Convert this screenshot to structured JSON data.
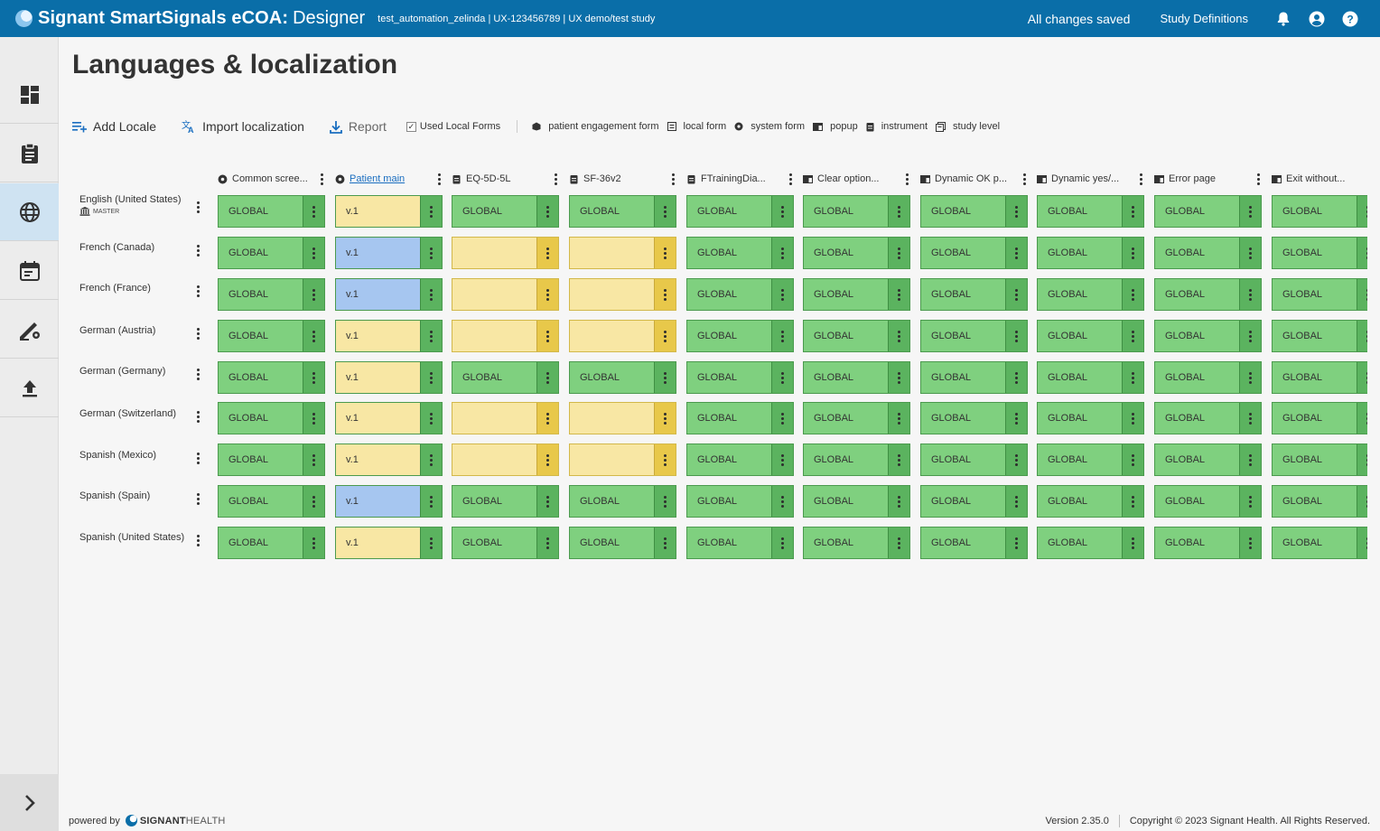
{
  "header": {
    "brand_title": "Signant SmartSignals eCOA:",
    "brand_sub": "Designer",
    "study_info": "test_automation_zelinda | UX-123456789 | UX demo/test study",
    "save_status": "All changes saved",
    "study_definitions": "Study Definitions",
    "icons": [
      "bell-icon",
      "account-icon",
      "help-icon"
    ]
  },
  "sidebar": {
    "items": [
      "dashboard-icon",
      "forms-icon",
      "globe-icon",
      "calendar-icon",
      "design-settings-icon",
      "upload-icon"
    ],
    "active": "globe-icon",
    "expand": "chevron-right-icon"
  },
  "page": {
    "title": "Languages & localization"
  },
  "toolbar": {
    "add_locale": "Add Locale",
    "import_localization": "Import localization",
    "report": "Report",
    "used_local_forms": "Used Local Forms",
    "used_local_forms_checked": true
  },
  "legend": {
    "patient_engagement_form": "patient engagement form",
    "local_form": "local form",
    "system_form": "system form",
    "popup": "popup",
    "instrument": "instrument",
    "study_level": "study level"
  },
  "columns": [
    {
      "label": "Common scree...",
      "icon": "system-form-icon"
    },
    {
      "label": "Patient main",
      "icon": "system-form-icon",
      "link": true
    },
    {
      "label": "EQ-5D-5L",
      "icon": "instrument-icon"
    },
    {
      "label": "SF-36v2",
      "icon": "instrument-icon"
    },
    {
      "label": "FTrainingDia...",
      "icon": "instrument-icon"
    },
    {
      "label": "Clear option...",
      "icon": "popup-icon"
    },
    {
      "label": "Dynamic OK p...",
      "icon": "popup-icon"
    },
    {
      "label": "Dynamic yes/...",
      "icon": "popup-icon"
    },
    {
      "label": "Error page",
      "icon": "popup-icon"
    },
    {
      "label": "Exit without...",
      "icon": "popup-icon"
    }
  ],
  "rows": [
    {
      "locale": "English (United States)",
      "badge": "MASTER",
      "cells": [
        [
          "GLOBAL",
          "green"
        ],
        [
          "v.1",
          "yellowg"
        ],
        [
          "GLOBAL",
          "green"
        ],
        [
          "GLOBAL",
          "green"
        ],
        [
          "GLOBAL",
          "green"
        ],
        [
          "GLOBAL",
          "green"
        ],
        [
          "GLOBAL",
          "green"
        ],
        [
          "GLOBAL",
          "green"
        ],
        [
          "GLOBAL",
          "green"
        ],
        [
          "GLOBAL",
          "green"
        ]
      ]
    },
    {
      "locale": "French (Canada)",
      "cells": [
        [
          "GLOBAL",
          "green"
        ],
        [
          "v.1",
          "blue"
        ],
        [
          "",
          "yellow"
        ],
        [
          "",
          "yellow"
        ],
        [
          "GLOBAL",
          "green"
        ],
        [
          "GLOBAL",
          "green"
        ],
        [
          "GLOBAL",
          "green"
        ],
        [
          "GLOBAL",
          "green"
        ],
        [
          "GLOBAL",
          "green"
        ],
        [
          "GLOBAL",
          "green"
        ]
      ]
    },
    {
      "locale": "French (France)",
      "cells": [
        [
          "GLOBAL",
          "green"
        ],
        [
          "v.1",
          "blue"
        ],
        [
          "",
          "yellow"
        ],
        [
          "",
          "yellow"
        ],
        [
          "GLOBAL",
          "green"
        ],
        [
          "GLOBAL",
          "green"
        ],
        [
          "GLOBAL",
          "green"
        ],
        [
          "GLOBAL",
          "green"
        ],
        [
          "GLOBAL",
          "green"
        ],
        [
          "GLOBAL",
          "green"
        ]
      ]
    },
    {
      "locale": "German (Austria)",
      "cells": [
        [
          "GLOBAL",
          "green"
        ],
        [
          "v.1",
          "yellowg"
        ],
        [
          "",
          "yellow"
        ],
        [
          "",
          "yellow"
        ],
        [
          "GLOBAL",
          "green"
        ],
        [
          "GLOBAL",
          "green"
        ],
        [
          "GLOBAL",
          "green"
        ],
        [
          "GLOBAL",
          "green"
        ],
        [
          "GLOBAL",
          "green"
        ],
        [
          "GLOBAL",
          "green"
        ]
      ]
    },
    {
      "locale": "German (Germany)",
      "cells": [
        [
          "GLOBAL",
          "green"
        ],
        [
          "v.1",
          "yellowg"
        ],
        [
          "GLOBAL",
          "green"
        ],
        [
          "GLOBAL",
          "green"
        ],
        [
          "GLOBAL",
          "green"
        ],
        [
          "GLOBAL",
          "green"
        ],
        [
          "GLOBAL",
          "green"
        ],
        [
          "GLOBAL",
          "green"
        ],
        [
          "GLOBAL",
          "green"
        ],
        [
          "GLOBAL",
          "green"
        ]
      ]
    },
    {
      "locale": "German (Switzerland)",
      "cells": [
        [
          "GLOBAL",
          "green"
        ],
        [
          "v.1",
          "yellowg"
        ],
        [
          "",
          "yellow"
        ],
        [
          "",
          "yellow"
        ],
        [
          "GLOBAL",
          "green"
        ],
        [
          "GLOBAL",
          "green"
        ],
        [
          "GLOBAL",
          "green"
        ],
        [
          "GLOBAL",
          "green"
        ],
        [
          "GLOBAL",
          "green"
        ],
        [
          "GLOBAL",
          "green"
        ]
      ]
    },
    {
      "locale": "Spanish (Mexico)",
      "cells": [
        [
          "GLOBAL",
          "green"
        ],
        [
          "v.1",
          "yellowg"
        ],
        [
          "",
          "yellow"
        ],
        [
          "",
          "yellow"
        ],
        [
          "GLOBAL",
          "green"
        ],
        [
          "GLOBAL",
          "green"
        ],
        [
          "GLOBAL",
          "green"
        ],
        [
          "GLOBAL",
          "green"
        ],
        [
          "GLOBAL",
          "green"
        ],
        [
          "GLOBAL",
          "green"
        ]
      ]
    },
    {
      "locale": "Spanish (Spain)",
      "cells": [
        [
          "GLOBAL",
          "green"
        ],
        [
          "v.1",
          "blue"
        ],
        [
          "GLOBAL",
          "green"
        ],
        [
          "GLOBAL",
          "green"
        ],
        [
          "GLOBAL",
          "green"
        ],
        [
          "GLOBAL",
          "green"
        ],
        [
          "GLOBAL",
          "green"
        ],
        [
          "GLOBAL",
          "green"
        ],
        [
          "GLOBAL",
          "green"
        ],
        [
          "GLOBAL",
          "green"
        ]
      ]
    },
    {
      "locale": "Spanish (United States)",
      "cells": [
        [
          "GLOBAL",
          "green"
        ],
        [
          "v.1",
          "yellowg"
        ],
        [
          "GLOBAL",
          "green"
        ],
        [
          "GLOBAL",
          "green"
        ],
        [
          "GLOBAL",
          "green"
        ],
        [
          "GLOBAL",
          "green"
        ],
        [
          "GLOBAL",
          "green"
        ],
        [
          "GLOBAL",
          "green"
        ],
        [
          "GLOBAL",
          "green"
        ],
        [
          "GLOBAL",
          "green"
        ]
      ]
    }
  ],
  "footer": {
    "powered_by": "powered by",
    "brand": "SIGNANT",
    "brand2": "HEALTH",
    "version": "Version 2.35.0",
    "copyright": "Copyright © 2023 Signant Health. All Rights Reserved."
  },
  "colors": {
    "topbar": "#0a6ea8",
    "cell_green": "#7fd07f",
    "cell_yellow": "#f8e7a4",
    "cell_blue": "#a6c6f0"
  }
}
